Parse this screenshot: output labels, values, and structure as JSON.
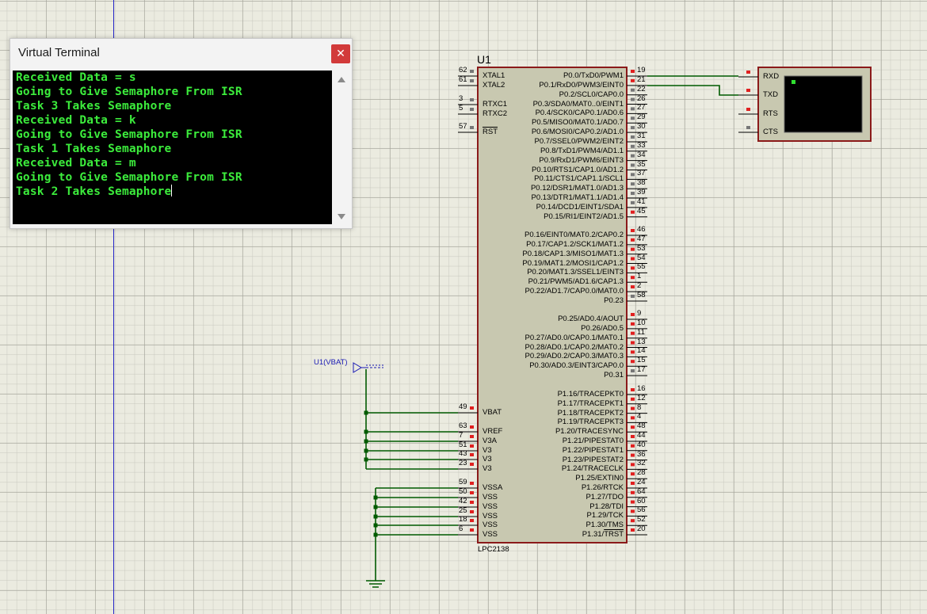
{
  "terminal": {
    "title": "Virtual Terminal",
    "close_icon": "close-icon",
    "lines": [
      "Received Data = s",
      "Going to Give Semaphore From ISR",
      "Task 3 Takes Semaphore",
      "Received Data = k",
      "Going to Give Semaphore From ISR",
      "Task 1 Takes Semaphore",
      "Received Data = m",
      "Going to Give Semaphore From ISR",
      "Task 2 Takes Semaphore"
    ]
  },
  "chip": {
    "ref": "U1",
    "part": "LPC2138",
    "left_pins": [
      {
        "num": "62",
        "label": "XTAL1"
      },
      {
        "num": "61",
        "label": "XTAL2"
      },
      {
        "num": "3",
        "label": "RTXC1"
      },
      {
        "num": "5",
        "label": "RTXC2"
      },
      {
        "num": "57",
        "label": "RST"
      },
      {
        "num": "49",
        "label": "VBAT"
      },
      {
        "num": "63",
        "label": "VREF"
      },
      {
        "num": "7",
        "label": "V3A"
      },
      {
        "num": "51",
        "label": "V3"
      },
      {
        "num": "43",
        "label": "V3"
      },
      {
        "num": "23",
        "label": "V3"
      },
      {
        "num": "59",
        "label": "VSSA"
      },
      {
        "num": "50",
        "label": "VSS"
      },
      {
        "num": "42",
        "label": "VSS"
      },
      {
        "num": "25",
        "label": "VSS"
      },
      {
        "num": "18",
        "label": "VSS"
      },
      {
        "num": "6",
        "label": "VSS"
      }
    ],
    "right_pins": [
      {
        "num": "19",
        "label": "P0.0/TxD0/PWM1"
      },
      {
        "num": "21",
        "label": "P0.1/RxD0/PWM3/EINT0"
      },
      {
        "num": "22",
        "label": "P0.2/SCL0/CAP0.0"
      },
      {
        "num": "26",
        "label": "P0.3/SDA0/MAT0..0/EINT1"
      },
      {
        "num": "27",
        "label": "P0.4/SCK0/CAP0.1/AD0.6"
      },
      {
        "num": "29",
        "label": "P0.5/MISO0/MAT0.1/AD0.7"
      },
      {
        "num": "30",
        "label": "P0.6/MOSI0/CAP0.2/AD1.0"
      },
      {
        "num": "31",
        "label": "P0.7/SSEL0/PWM2/EINT2"
      },
      {
        "num": "33",
        "label": "P0.8/TxD1/PWM4/AD1.1"
      },
      {
        "num": "34",
        "label": "P0.9/RxD1/PWM6/EINT3"
      },
      {
        "num": "35",
        "label": "P0.10/RTS1/CAP1.0/AD1.2"
      },
      {
        "num": "37",
        "label": "P0.11/CTS1/CAP1.1/SCL1"
      },
      {
        "num": "38",
        "label": "P0.12/DSR1/MAT1.0/AD1.3"
      },
      {
        "num": "39",
        "label": "P0.13/DTR1/MAT1.1/AD1.4"
      },
      {
        "num": "41",
        "label": "P0.14/DCD1/EINT1/SDA1"
      },
      {
        "num": "45",
        "label": "P0.15/RI1/EINT2/AD1.5"
      },
      {
        "num": "46",
        "label": "P0.16/EINT0/MAT0.2/CAP0.2"
      },
      {
        "num": "47",
        "label": "P0.17/CAP1.2/SCK1/MAT1.2"
      },
      {
        "num": "53",
        "label": "P0.18/CAP1.3/MISO1/MAT1.3"
      },
      {
        "num": "54",
        "label": "P0.19/MAT1.2/MOSI1/CAP1.2"
      },
      {
        "num": "55",
        "label": "P0.20/MAT1.3/SSEL1/EINT3"
      },
      {
        "num": "1",
        "label": "P0.21/PWM5/AD1.6/CAP1.3"
      },
      {
        "num": "2",
        "label": "P0.22/AD1.7/CAP0.0/MAT0.0"
      },
      {
        "num": "58",
        "label": "P0.23"
      },
      {
        "num": "9",
        "label": "P0.25/AD0.4/AOUT"
      },
      {
        "num": "10",
        "label": "P0.26/AD0.5"
      },
      {
        "num": "11",
        "label": "P0.27/AD0.0/CAP0.1/MAT0.1"
      },
      {
        "num": "13",
        "label": "P0.28/AD0.1/CAP0.2/MAT0.2"
      },
      {
        "num": "14",
        "label": "P0.29/AD0.2/CAP0.3/MAT0.3"
      },
      {
        "num": "15",
        "label": "P0.30/AD0.3/EINT3/CAP0.0"
      },
      {
        "num": "17",
        "label": "P0.31"
      },
      {
        "num": "16",
        "label": "P1.16/TRACEPKT0"
      },
      {
        "num": "12",
        "label": "P1.17/TRACEPKT1"
      },
      {
        "num": "8",
        "label": "P1.18/TRACEPKT2"
      },
      {
        "num": "4",
        "label": "P1.19/TRACEPKT3"
      },
      {
        "num": "48",
        "label": "P1.20/TRACESYNC"
      },
      {
        "num": "44",
        "label": "P1.21/PIPESTAT0"
      },
      {
        "num": "40",
        "label": "P1.22/PIPESTAT1"
      },
      {
        "num": "36",
        "label": "P1.23/PIPESTAT2"
      },
      {
        "num": "32",
        "label": "P1.24/TRACECLK"
      },
      {
        "num": "28",
        "label": "P1.25/EXTIN0"
      },
      {
        "num": "24",
        "label": "P1.26/RTCK"
      },
      {
        "num": "64",
        "label": "P1.27/TDO"
      },
      {
        "num": "60",
        "label": "P1.28/TDI"
      },
      {
        "num": "56",
        "label": "P1.29/TCK"
      },
      {
        "num": "52",
        "label": "P1.30/TMS"
      },
      {
        "num": "20",
        "label": "P1.31/TRST"
      }
    ]
  },
  "vterm": {
    "pins": [
      "RXD",
      "TXD",
      "RTS",
      "CTS"
    ]
  },
  "vbat_label": "U1(VBAT)",
  "colors": {
    "terminal_text": "#3cec3c",
    "chip_fill": "#c8c8b0",
    "chip_border": "#8b1a1a",
    "wire": "#005a00",
    "pin_red": "#e02020"
  }
}
